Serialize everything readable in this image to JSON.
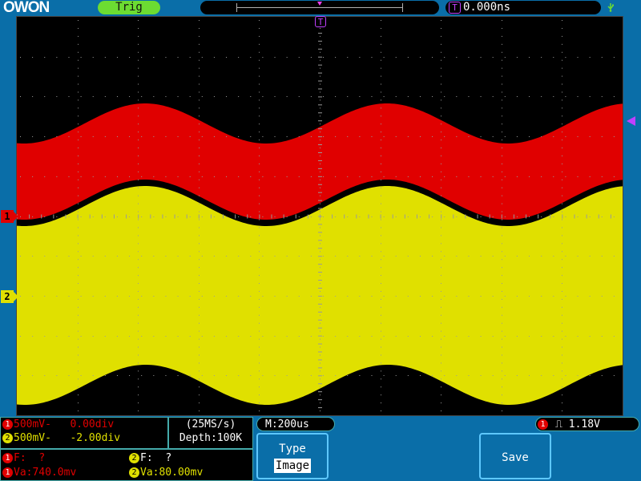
{
  "brand": {
    "logo_text": "OWON"
  },
  "top": {
    "trig_status": "Trig",
    "trigger_badge": "T",
    "trigger_position": "0.000ns"
  },
  "channels": [
    {
      "marker": "1",
      "color": "#e00000",
      "volts_div": "500mV",
      "coupling_symbol": "-",
      "offset": "0.00div"
    },
    {
      "marker": "2",
      "color": "#e0e000",
      "volts_div": "500mV",
      "coupling_symbol": "-",
      "offset": "-2.00div"
    }
  ],
  "acquisition": {
    "sample_rate": "(25MS/s)",
    "depth": "Depth:100K"
  },
  "timebase": {
    "main": "M:200us"
  },
  "trigger": {
    "source_marker": "1",
    "slope_symbol": "⎍",
    "level": "1.18V"
  },
  "measurements": {
    "ch1": {
      "freq_label": "F:",
      "freq_value": "?",
      "va_label": "Va:",
      "va_value": "740.0mv"
    },
    "ch2": {
      "freq_label": "F:",
      "freq_value": "?",
      "va_label": "Va:",
      "va_value": "80.00mv"
    }
  },
  "menu": {
    "type_label": "Type",
    "type_value": "Image",
    "save_label": "Save"
  },
  "markers": {
    "trigger_screen": "T",
    "ch1": "1",
    "ch2": "2"
  },
  "colors": {
    "ch1": "#e00000",
    "ch2": "#e0e000",
    "trigger": "#c040ff",
    "trig_status": "#6cdc32"
  }
}
